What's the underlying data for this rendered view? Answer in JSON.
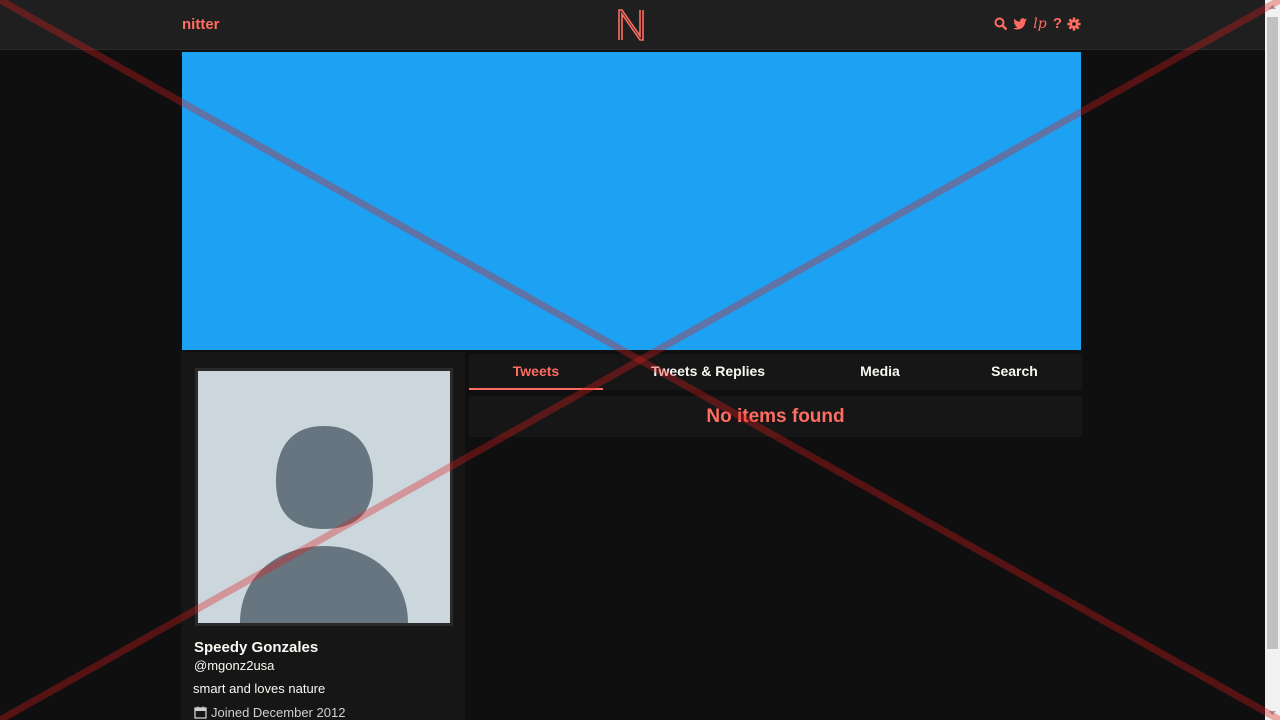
{
  "nav": {
    "brand": "nitter",
    "logo_letter": "N",
    "icons": [
      "search-icon",
      "twitter-bird-icon",
      "lp-icon",
      "help-icon",
      "gear-icon"
    ],
    "lp_glyph": "lp",
    "help_glyph": "?"
  },
  "banner": {
    "color": "#1da1f2"
  },
  "profile": {
    "fullname": "Speedy Gonzales",
    "username": "@mgonz2usa",
    "bio": "smart and loves nature",
    "joined": "Joined December 2012"
  },
  "tabs": [
    {
      "label": "Tweets",
      "active": true
    },
    {
      "label": "Tweets & Replies",
      "active": false
    },
    {
      "label": "Media",
      "active": false
    },
    {
      "label": "Search",
      "active": false
    }
  ],
  "timeline": {
    "empty_message": "No items found"
  },
  "colors": {
    "accent": "#ff6c60",
    "background": "#0f0f0f",
    "panel": "#161616",
    "navbar": "#1f1f1f"
  }
}
